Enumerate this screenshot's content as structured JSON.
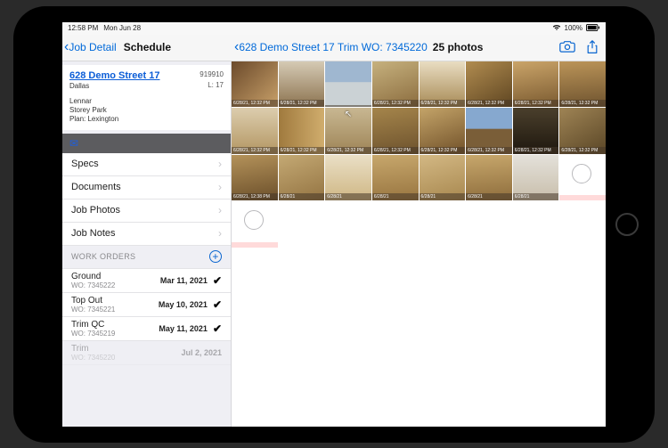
{
  "status": {
    "time": "12:58 PM",
    "date": "Mon Jun 28",
    "battery": "100%"
  },
  "nav": {
    "left_back": "Job Detail",
    "left_title": "Schedule",
    "center_back": "628 Demo Street 17  Trim WO: 7345220",
    "photo_count": "25 photos"
  },
  "job": {
    "address": "628 Demo Street 17",
    "code": "919910",
    "city": "Dallas",
    "lot": "L: 17",
    "builder": "Lennar",
    "community": "Storey Park",
    "plan": "Plan: Lexington"
  },
  "sections": {
    "items": [
      {
        "label": "Specs"
      },
      {
        "label": "Documents"
      },
      {
        "label": "Job Photos"
      },
      {
        "label": "Job Notes"
      }
    ],
    "wo_header": "WORK ORDERS",
    "work_orders": [
      {
        "name": "Ground",
        "id": "WO: 7345222",
        "date": "Mar 11, 2021",
        "done": true
      },
      {
        "name": "Top Out",
        "id": "WO: 7345221",
        "date": "May 10, 2021",
        "done": true
      },
      {
        "name": "Trim QC",
        "id": "WO: 7345219",
        "date": "May 11, 2021",
        "done": true
      },
      {
        "name": "Trim",
        "id": "WO: 7345220",
        "date": "Jul 2, 2021",
        "done": false,
        "dim": true
      }
    ]
  },
  "photos": {
    "ts": [
      "6/28/21, 12:32 PM",
      "6/28/21, 12:32 PM",
      "",
      "6/28/21, 12:32 PM",
      "6/28/21, 12:32 PM",
      "6/28/21, 12:32 PM",
      "6/28/21, 12:32 PM",
      "6/28/21, 12:32 PM",
      "6/28/21, 12:32 PM",
      "6/28/21, 12:32 PM",
      "6/28/21, 12:32 PM",
      "6/28/21, 12:32 PM",
      "6/28/21, 12:32 PM",
      "6/28/21, 12:32 PM",
      "6/28/21, 12:32 PM",
      "6/28/21, 12:32 PM",
      "6/28/21, 12:38 PM",
      "6/28/21",
      "6/28/21",
      "6/28/21",
      "6/28/21",
      "6/28/21",
      "6/28/21"
    ]
  }
}
